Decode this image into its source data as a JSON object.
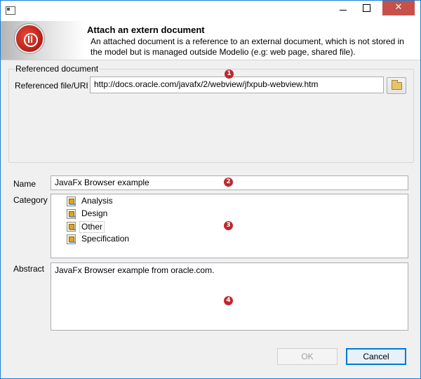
{
  "window": {
    "icon": "window-icon",
    "close_glyph": "✕"
  },
  "banner": {
    "title": "Attach an extern document",
    "description": "An attached document is a reference to an external document, which is not stored in the model but is managed outside Modelio (e.g: web page, shared file).",
    "logo_icon": "modelio-logo"
  },
  "referenced_document": {
    "group_label": "Referenced document",
    "file_label": "Referenced file/URI",
    "file_value": "http://docs.oracle.com/javafx/2/webview/jfxpub-webview.htm",
    "browse_icon": "folder-open-icon"
  },
  "name": {
    "label": "Name",
    "value": "JavaFx Browser example"
  },
  "category": {
    "label": "Category",
    "items": [
      {
        "label": "Analysis",
        "selected": false
      },
      {
        "label": "Design",
        "selected": false
      },
      {
        "label": "Other",
        "selected": true
      },
      {
        "label": "Specification",
        "selected": false
      }
    ]
  },
  "abstract": {
    "label": "Abstract",
    "value": "JavaFx Browser example from oracle.com."
  },
  "markers": [
    "1",
    "2",
    "3",
    "4"
  ],
  "buttons": {
    "ok": "OK",
    "cancel": "Cancel"
  },
  "colors": {
    "marker": "#c1272d",
    "close_button": "#c7504a",
    "default_button_border": "#0078d7"
  }
}
